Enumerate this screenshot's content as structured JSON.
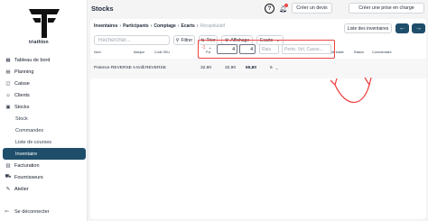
{
  "brand": {
    "name": "triathlon"
  },
  "sidebar": {
    "items": [
      {
        "label": "Tableau de bord",
        "icon": "dashboard-icon"
      },
      {
        "label": "Planning",
        "icon": "calendar-icon"
      },
      {
        "label": "Caisse",
        "icon": "cash-register-icon"
      },
      {
        "label": "Clients",
        "icon": "users-icon"
      },
      {
        "label": "Stocks",
        "icon": "box-icon"
      }
    ],
    "sub_items": [
      "Stock",
      "Commandes",
      "Liste de courses",
      "Inventaire"
    ],
    "items_after": [
      {
        "label": "Facturation",
        "icon": "invoice-icon"
      },
      {
        "label": "Fournisseurs",
        "icon": "truck-icon"
      },
      {
        "label": "Atelier",
        "icon": "wrench-icon"
      }
    ],
    "logout_label": "Se déconnecter"
  },
  "header": {
    "title": "Stocks",
    "devis_button": "Créer un devis",
    "prise_button": "Créer une prise en charge"
  },
  "breadcrumb": {
    "items": [
      "Inventaires",
      "Participants",
      "Comptage",
      "Ecarts"
    ],
    "last": "Récapitulatif"
  },
  "toolbar": {
    "search_placeholder": "Rechercher...",
    "filter_label": "Filtrer",
    "sort_label": "Trier",
    "display_label": "Affichage",
    "select_value": "Ecarts",
    "list_button": "Liste des inventaires"
  },
  "table": {
    "headers": [
      "Nom",
      "Marque",
      "Code SKU",
      "P.A",
      "PMPa",
      "P.V",
      "Qté stock",
      "Ecarts",
      "Qté",
      "Qté totale",
      "Raison",
      "Commentaire"
    ],
    "rows": [
      {
        "name": "Potence REVERSE s-trolli",
        "brand": "REVERSE",
        "sku": "",
        "pa": "32,90",
        "pmpa": "32,90",
        "pv": "65,80",
        "stock": "5",
        "ecart": "-1",
        "qte": "4",
        "qte_totale": "4",
        "raison_placeholder": "Rais",
        "comment_placeholder": "Perte, Vol, Casse..."
      }
    ]
  },
  "colors": {
    "primary": "#1f4e6b",
    "highlight": "#ef4444"
  }
}
